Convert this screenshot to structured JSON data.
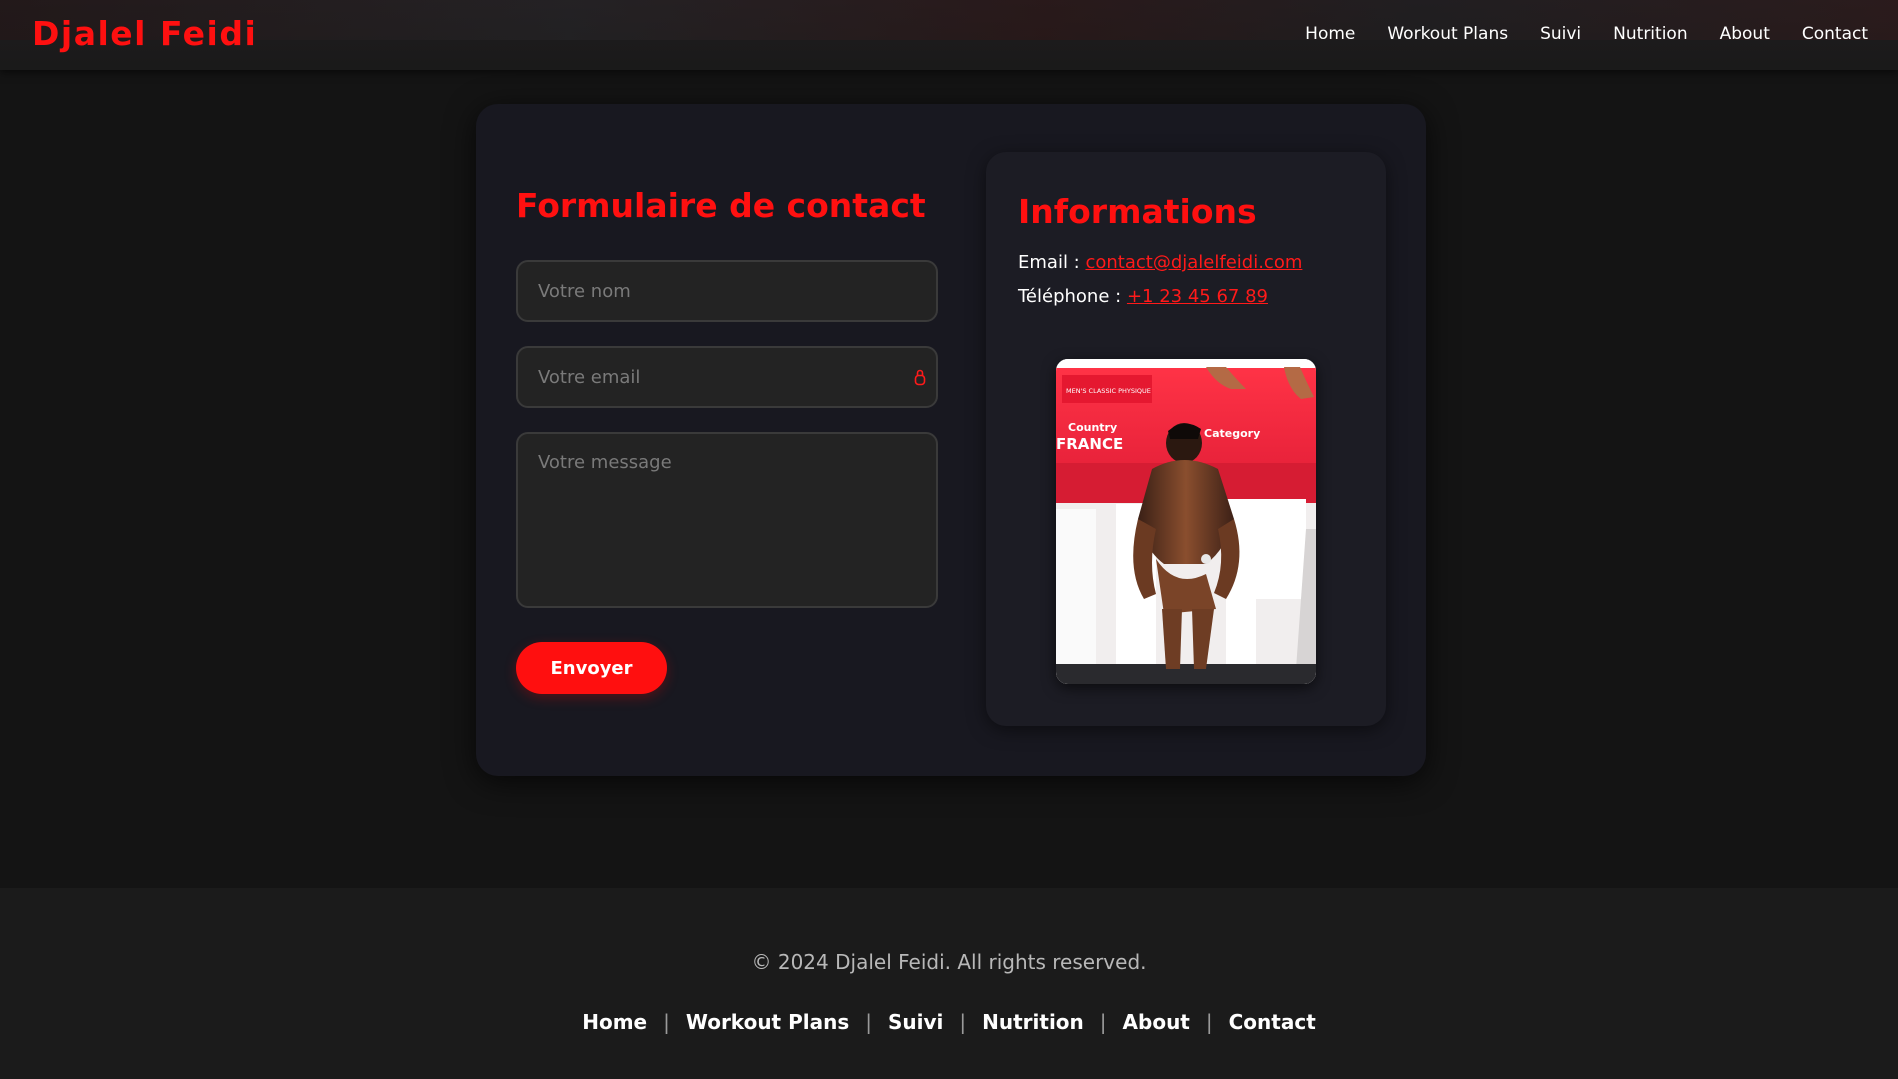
{
  "header": {
    "brand": "Djalel Feidi",
    "nav": [
      "Home",
      "Workout Plans",
      "Suivi",
      "Nutrition",
      "About",
      "Contact"
    ]
  },
  "form": {
    "title": "Formulaire de contact",
    "name_placeholder": "Votre nom",
    "email_placeholder": "Votre email",
    "message_placeholder": "Votre message",
    "submit_label": "Envoyer"
  },
  "info": {
    "title": "Informations",
    "email_label": "Email :",
    "email_value": "contact@djalelfeidi.com",
    "phone_label": "Téléphone :",
    "phone_value": "+1 23 45 67 89",
    "photo": {
      "banner_text": "MEN'S CLASSIC PHYSIQUE",
      "country_label": "Country",
      "country_value": "FRANCE",
      "category_label": "Category"
    }
  },
  "footer": {
    "copyright": "© 2024 Djalel Feidi. All rights reserved.",
    "links": [
      "Home",
      "Workout Plans",
      "Suivi",
      "Nutrition",
      "About",
      "Contact"
    ],
    "separator": "|"
  },
  "colors": {
    "accent": "#ff1010",
    "background": "#141414",
    "card": "#181820",
    "footer": "#1b1b1b"
  }
}
